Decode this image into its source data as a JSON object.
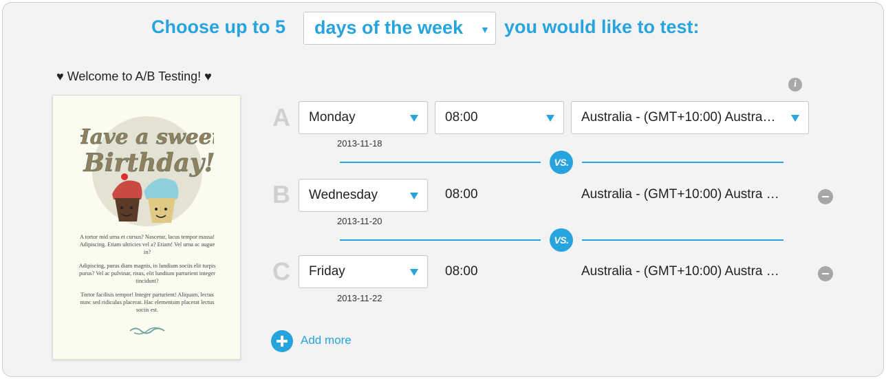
{
  "header": {
    "prefix": "Choose up to 5",
    "selector_value": "days of the week",
    "selector_arrow": "▼",
    "suffix": "you would like to test:"
  },
  "preview": {
    "welcome": "♥ Welcome to A/B Testing! ♥",
    "headline_line1": "Have a sweet",
    "headline_line2": "Birthday!",
    "paragraphs": [
      "A tortor mid urna et cursus? Nascetur, lacus tempor massa! Adipiscing. Etiam ultricies vel a? Etiam! Vel urna ac augue in?",
      "Adipiscing, purus diam magnis, in lundium sociis elit turpis purus? Vel ac pulvinar, risus, elit lundium parturient integer tincidunt?",
      "Tortor facilisis tempor! Integer parturient! Aliquam, lectus nunc sed ridiculus placerat. Hac elementum placerat lectus sociis est."
    ]
  },
  "info_icon": "i",
  "rows": [
    {
      "letter": "A",
      "day": "Monday",
      "time": "08:00",
      "timezone": "Australia - (GMT+10:00) Austra…",
      "date": "2013-11-18"
    },
    {
      "letter": "B",
      "day": "Wednesday",
      "time": "08:00",
      "timezone": "Australia - (GMT+10:00) Austra …",
      "date": "2013-11-20"
    },
    {
      "letter": "C",
      "day": "Friday",
      "time": "08:00",
      "timezone": "Australia - (GMT+10:00) Austra …",
      "date": "2013-11-22"
    }
  ],
  "vs_label": "VS.",
  "add_more": "Add more",
  "colors": {
    "accent": "#27a4dd",
    "muted": "#a6a6a6"
  },
  "icons": {
    "info": "info-icon",
    "remove": "minus-circle-icon",
    "add": "plus-circle-icon",
    "caret": "caret-down-icon"
  }
}
